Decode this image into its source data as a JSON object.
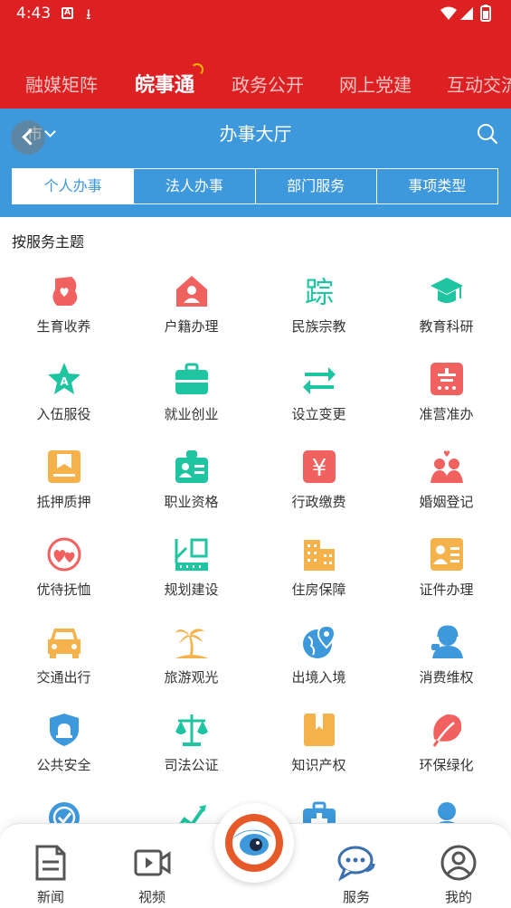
{
  "status_bar": {
    "time": "4:43"
  },
  "top_tabs": [
    {
      "label": "融媒矩阵",
      "active": false
    },
    {
      "label": "皖事通",
      "active": true
    },
    {
      "label": "政务公开",
      "active": false
    },
    {
      "label": "网上党建",
      "active": false
    },
    {
      "label": "互动交流",
      "active": false
    }
  ],
  "hall": {
    "city": "市",
    "title": "办事大厅",
    "segments": [
      {
        "label": "个人办事",
        "active": true
      },
      {
        "label": "法人办事",
        "active": false
      },
      {
        "label": "部门服务",
        "active": false
      },
      {
        "label": "事项类型",
        "active": false
      }
    ]
  },
  "section": {
    "title": "按服务主题",
    "items": [
      {
        "label": "生育收养",
        "icon": "pregnancy-icon",
        "color": "#f0615f"
      },
      {
        "label": "户籍办理",
        "icon": "house-person-icon",
        "color": "#f0615f"
      },
      {
        "label": "民族宗教",
        "icon": "ethnic-character-icon",
        "color": "#1ec5a0"
      },
      {
        "label": "教育科研",
        "icon": "graduation-cap-icon",
        "color": "#1ec5a0"
      },
      {
        "label": "入伍服役",
        "icon": "army-star-icon",
        "color": "#1ec5a0"
      },
      {
        "label": "就业创业",
        "icon": "briefcase-icon",
        "color": "#1ec5a0"
      },
      {
        "label": "设立变更",
        "icon": "swap-arrows-icon",
        "color": "#1ec5a0"
      },
      {
        "label": "准营准办",
        "icon": "license-icon",
        "color": "#f0615f"
      },
      {
        "label": "抵押质押",
        "icon": "mortgage-book-icon",
        "color": "#f5b14a"
      },
      {
        "label": "职业资格",
        "icon": "id-badge-icon",
        "color": "#1ec5a0"
      },
      {
        "label": "行政缴费",
        "icon": "yuan-icon",
        "color": "#f0615f"
      },
      {
        "label": "婚姻登记",
        "icon": "couple-icon",
        "color": "#f0615f"
      },
      {
        "label": "优待抚恤",
        "icon": "care-hearts-icon",
        "color": "#f0615f"
      },
      {
        "label": "规划建设",
        "icon": "planning-icon",
        "color": "#1ec5a0"
      },
      {
        "label": "住房保障",
        "icon": "buildings-icon",
        "color": "#f5b14a"
      },
      {
        "label": "证件办理",
        "icon": "id-card-icon",
        "color": "#f5b14a"
      },
      {
        "label": "交通出行",
        "icon": "car-icon",
        "color": "#f5b14a"
      },
      {
        "label": "旅游观光",
        "icon": "palm-tree-icon",
        "color": "#f5b14a"
      },
      {
        "label": "出境入境",
        "icon": "globe-pin-icon",
        "color": "#3d98dc"
      },
      {
        "label": "消费维权",
        "icon": "service-person-icon",
        "color": "#3d98dc"
      },
      {
        "label": "公共安全",
        "icon": "shield-alarm-icon",
        "color": "#3d98dc"
      },
      {
        "label": "司法公证",
        "icon": "scales-icon",
        "color": "#1ec5a0"
      },
      {
        "label": "知识产权",
        "icon": "book-ribbon-icon",
        "color": "#f5b14a"
      },
      {
        "label": "环保绿化",
        "icon": "leaf-icon",
        "color": "#f0615f"
      }
    ],
    "partial_icons": [
      {
        "icon": "check-badge-icon",
        "color": "#3d98dc"
      },
      {
        "icon": "chart-icon",
        "color": "#1ec5a0"
      },
      {
        "icon": "medical-kit-icon",
        "color": "#3d98dc"
      },
      {
        "icon": "person-icon",
        "color": "#3d98dc"
      }
    ]
  },
  "bottom_nav": [
    {
      "label": "新闻",
      "icon": "news-icon"
    },
    {
      "label": "视频",
      "icon": "video-icon"
    },
    {
      "label": "",
      "icon": "home-eye-icon"
    },
    {
      "label": "服务",
      "icon": "chat-bubbles-icon",
      "active": true
    },
    {
      "label": "我的",
      "icon": "profile-icon"
    }
  ]
}
